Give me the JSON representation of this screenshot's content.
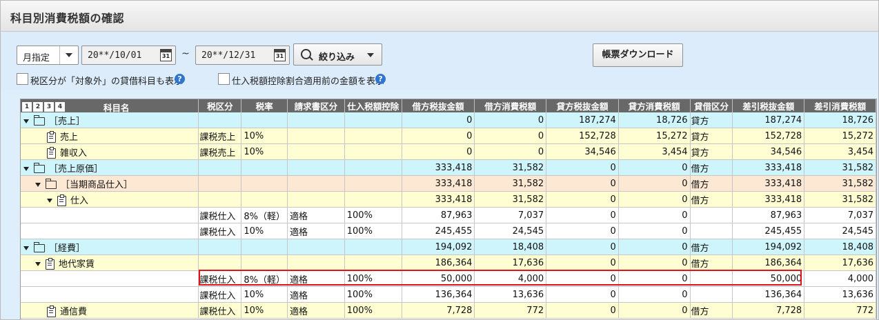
{
  "window": {
    "title": "科目別消費税額の確認"
  },
  "toolbar": {
    "period_select": "月指定",
    "date_from": "20**/10/01",
    "date_to": "20**/12/31",
    "range_separator": "~",
    "calendar_day": "31",
    "filter_label": "絞り込み",
    "download_label": "帳票ダウンロード",
    "option1_label": "税区分が「対象外」の貸借科目も表示",
    "option2_label": "仕入税額控除割合適用前の金額を表示",
    "help_glyph": "?"
  },
  "table": {
    "level_buttons": [
      "1",
      "2",
      "3",
      "4"
    ],
    "headers": {
      "account": "科目名",
      "tax_class": "税区分",
      "rate": "税率",
      "invoice": "請求書区分",
      "deduction": "仕入税額控除",
      "debit_net": "借方税抜金額",
      "debit_tax": "借方消費税額",
      "credit_net": "貸方税抜金額",
      "credit_tax": "貸方消費税額",
      "side": "貸借区分",
      "diff_net": "差引税抜金額",
      "diff_tax": "差引消費税額"
    },
    "rows": [
      {
        "account": "［売上］",
        "tax_class": "",
        "rate": "",
        "invoice": "",
        "deduction": "",
        "debit_net": "0",
        "debit_tax": "0",
        "credit_net": "187,274",
        "credit_tax": "18,726",
        "side": "貸方",
        "diff_net": "187,274",
        "diff_tax": "18,726"
      },
      {
        "account": "売上",
        "tax_class": "課税売上",
        "rate": "10%",
        "invoice": "",
        "deduction": "",
        "debit_net": "0",
        "debit_tax": "0",
        "credit_net": "152,728",
        "credit_tax": "15,272",
        "side": "貸方",
        "diff_net": "152,728",
        "diff_tax": "15,272"
      },
      {
        "account": "雑収入",
        "tax_class": "課税売上",
        "rate": "10%",
        "invoice": "",
        "deduction": "",
        "debit_net": "0",
        "debit_tax": "0",
        "credit_net": "34,546",
        "credit_tax": "3,454",
        "side": "貸方",
        "diff_net": "34,546",
        "diff_tax": "3,454"
      },
      {
        "account": "［売上原価］",
        "tax_class": "",
        "rate": "",
        "invoice": "",
        "deduction": "",
        "debit_net": "333,418",
        "debit_tax": "31,582",
        "credit_net": "0",
        "credit_tax": "0",
        "side": "借方",
        "diff_net": "333,418",
        "diff_tax": "31,582"
      },
      {
        "account": "［当期商品仕入］",
        "tax_class": "",
        "rate": "",
        "invoice": "",
        "deduction": "",
        "debit_net": "333,418",
        "debit_tax": "31,582",
        "credit_net": "0",
        "credit_tax": "0",
        "side": "借方",
        "diff_net": "333,418",
        "diff_tax": "31,582"
      },
      {
        "account": "仕入",
        "tax_class": "",
        "rate": "",
        "invoice": "",
        "deduction": "",
        "debit_net": "333,418",
        "debit_tax": "31,582",
        "credit_net": "0",
        "credit_tax": "0",
        "side": "借方",
        "diff_net": "333,418",
        "diff_tax": "31,582"
      },
      {
        "account": "",
        "tax_class": "課税仕入",
        "rate": "8%（軽）",
        "invoice": "適格",
        "deduction": "100%",
        "debit_net": "87,963",
        "debit_tax": "7,037",
        "credit_net": "0",
        "credit_tax": "0",
        "side": "",
        "diff_net": "87,963",
        "diff_tax": "7,037"
      },
      {
        "account": "",
        "tax_class": "課税仕入",
        "rate": "10%",
        "invoice": "適格",
        "deduction": "100%",
        "debit_net": "245,455",
        "debit_tax": "24,545",
        "credit_net": "0",
        "credit_tax": "0",
        "side": "",
        "diff_net": "245,455",
        "diff_tax": "24,545"
      },
      {
        "account": "［経費］",
        "tax_class": "",
        "rate": "",
        "invoice": "",
        "deduction": "",
        "debit_net": "194,092",
        "debit_tax": "18,408",
        "credit_net": "0",
        "credit_tax": "0",
        "side": "借方",
        "diff_net": "194,092",
        "diff_tax": "18,408"
      },
      {
        "account": "地代家賃",
        "tax_class": "",
        "rate": "",
        "invoice": "",
        "deduction": "",
        "debit_net": "186,364",
        "debit_tax": "17,636",
        "credit_net": "0",
        "credit_tax": "0",
        "side": "借方",
        "diff_net": "186,364",
        "diff_tax": "17,636"
      },
      {
        "account": "",
        "tax_class": "課税仕入",
        "rate": "8%（軽）",
        "invoice": "適格",
        "deduction": "100%",
        "debit_net": "50,000",
        "debit_tax": "4,000",
        "credit_net": "0",
        "credit_tax": "0",
        "side": "",
        "diff_net": "50,000",
        "diff_tax": "4,000"
      },
      {
        "account": "",
        "tax_class": "課税仕入",
        "rate": "10%",
        "invoice": "適格",
        "deduction": "100%",
        "debit_net": "136,364",
        "debit_tax": "13,636",
        "credit_net": "0",
        "credit_tax": "0",
        "side": "",
        "diff_net": "136,364",
        "diff_tax": "13,636"
      },
      {
        "account": "通信費",
        "tax_class": "課税仕入",
        "rate": "10%",
        "invoice": "適格",
        "deduction": "100%",
        "debit_net": "7,728",
        "debit_tax": "772",
        "credit_net": "0",
        "credit_tax": "0",
        "side": "借方",
        "diff_net": "7,728",
        "diff_tax": "772"
      }
    ]
  },
  "colors": {
    "group_row": "#cff5fc",
    "subgroup_row": "#fde8d4",
    "account_row": "#fefed2",
    "header": "#686868",
    "highlight": "#e0121a"
  }
}
